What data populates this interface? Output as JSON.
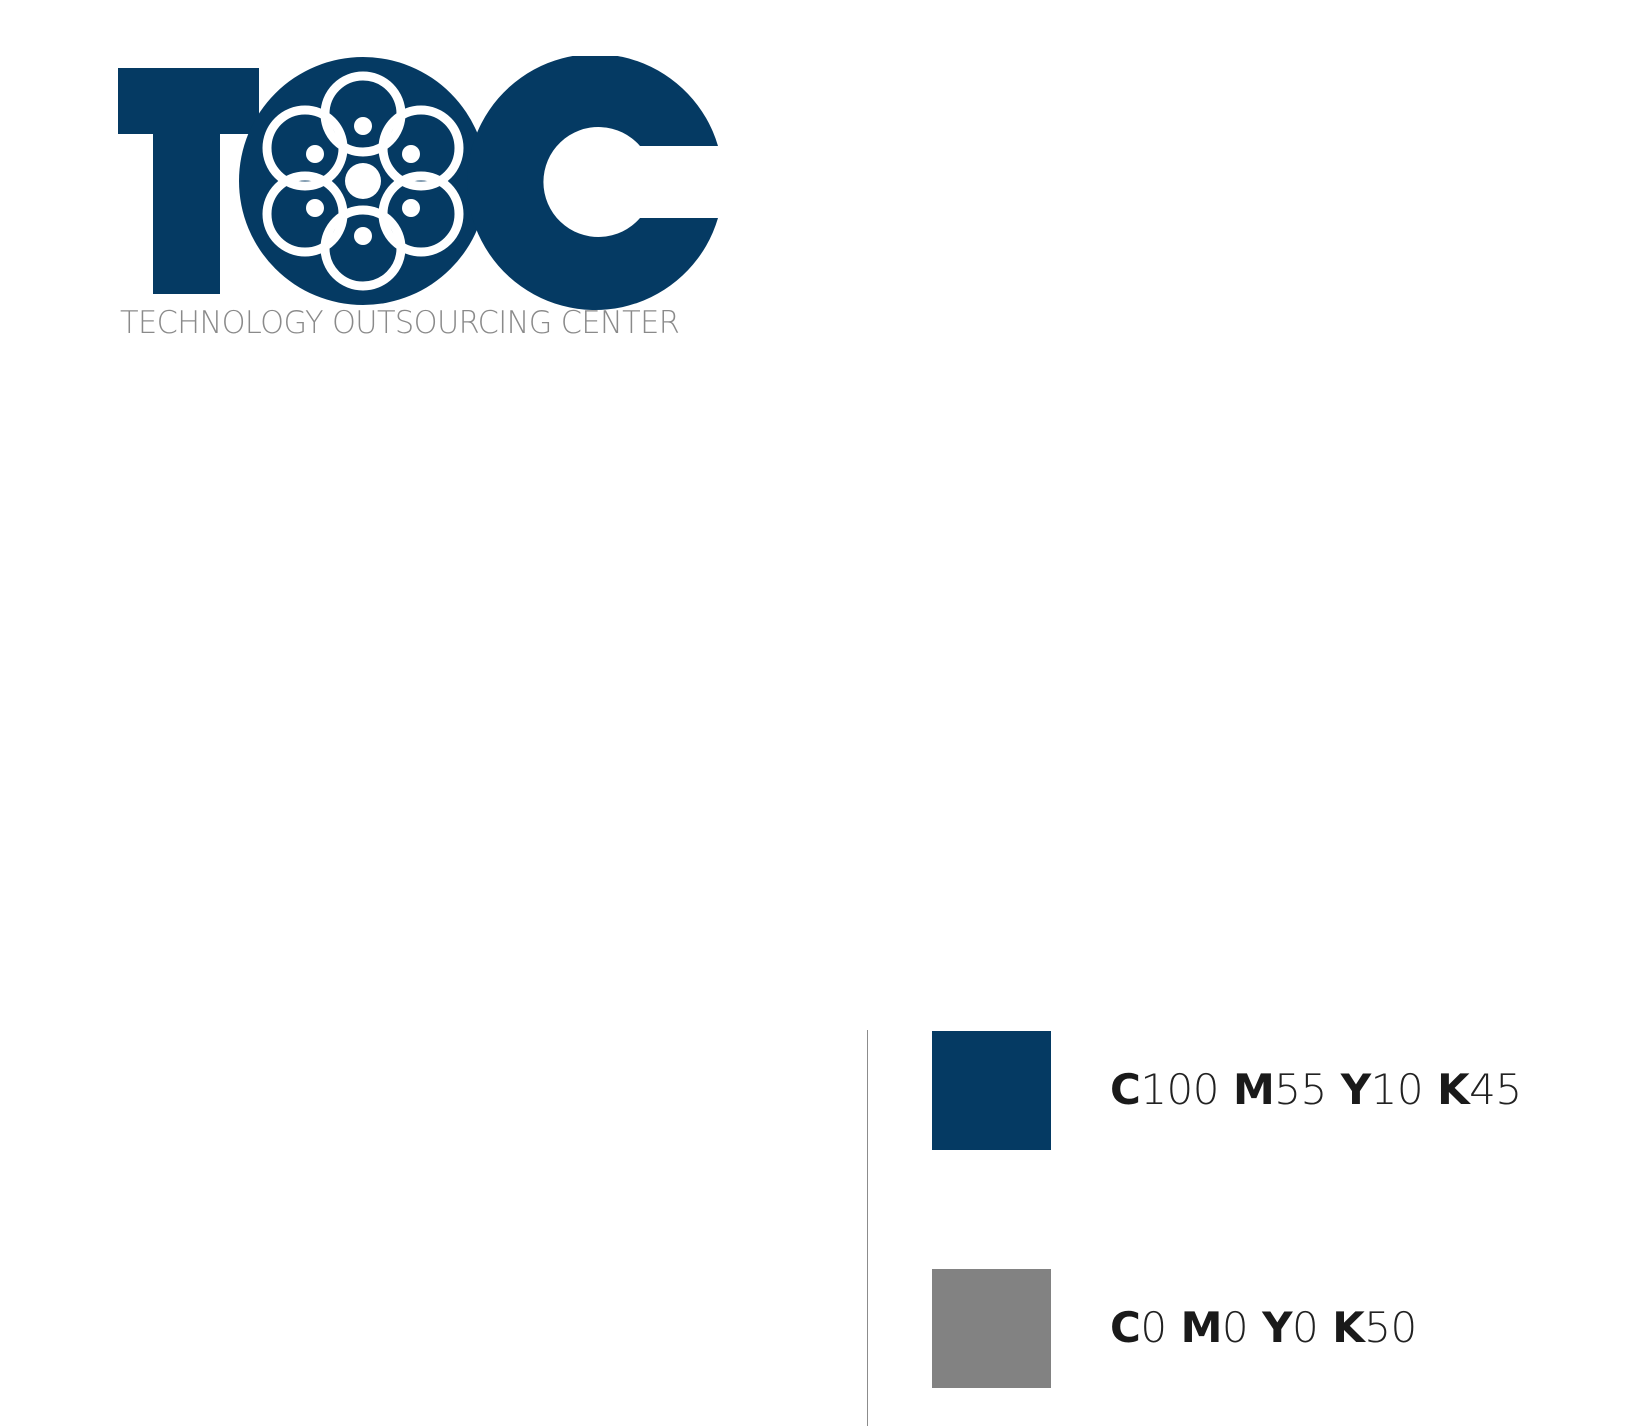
{
  "logo": {
    "wordmark": "TOC",
    "tagline": "TECHNOLOGY OUTSOURCING CENTER"
  },
  "colors": {
    "primary": "#053a63",
    "secondary": "#828282",
    "tagline": "#8a8a8a"
  },
  "palette": [
    {
      "name": "primary-blue",
      "color": "#053a63",
      "c_label": "C",
      "c_value": "100",
      "m_label": "M",
      "m_value": "55",
      "y_label": "Y",
      "y_value": "10",
      "k_label": "K",
      "k_value": "45"
    },
    {
      "name": "gray",
      "color": "#828282",
      "c_label": "C",
      "c_value": "0",
      "m_label": "M",
      "m_value": "0",
      "y_label": "Y",
      "y_value": "0",
      "k_label": "K",
      "k_value": "50"
    }
  ]
}
